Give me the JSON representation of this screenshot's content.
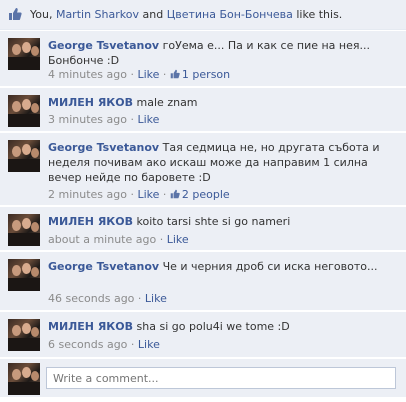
{
  "likes": {
    "prefix": "You, ",
    "name1": "Martin Sharkov",
    "mid": " and ",
    "name2": "Цветина Бон-Бончева",
    "suffix": " like this."
  },
  "comments": [
    {
      "author": "George Tsvetanov",
      "text": "гоУема е... Па и как се пие на нея... Бонбонче :D",
      "time": "4 minutes ago",
      "sep": " · ",
      "like_label": "Like",
      "like_count": "1 person"
    },
    {
      "author": "МИЛЕН ЯКОВ",
      "text": "male znam",
      "time": "3 minutes ago",
      "sep": " · ",
      "like_label": "Like"
    },
    {
      "author": "George Tsvetanov",
      "text": "Тая седмица не, но другата събота и неделя почивам ако искаш може да направим 1 силна вечер нейде по баровете :D",
      "time": "2 minutes ago",
      "sep": " · ",
      "like_label": "Like",
      "like_count": "2 people"
    },
    {
      "author": "МИЛЕН ЯКОВ",
      "text": "koito tarsi shte si go nameri",
      "time": "about a minute ago",
      "sep": " · ",
      "like_label": "Like"
    },
    {
      "author": "George Tsvetanov",
      "text": "Че и черния дроб си иска неговото...",
      "time": "46 seconds ago",
      "sep": " · ",
      "like_label": "Like"
    },
    {
      "author": "МИЛЕН ЯКОВ",
      "text": "sha si go polu4i we tome :D",
      "time": "6 seconds ago",
      "sep": " · ",
      "like_label": "Like"
    }
  ],
  "composer": {
    "placeholder": "Write a comment..."
  },
  "icons": {
    "thumbs_up": "thumbs-up-icon"
  },
  "colors": {
    "link": "#3b5998",
    "panel": "#eceff5",
    "meta": "#8b8b8b"
  }
}
